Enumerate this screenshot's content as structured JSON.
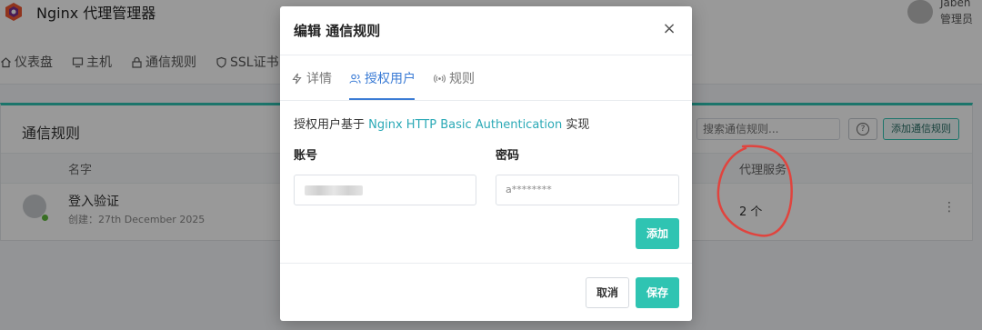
{
  "app": {
    "brand": "Nginx 代理管理器",
    "user_name": "Jaben",
    "user_role": "管理员"
  },
  "nav": [
    {
      "label": "仪表盘",
      "icon": "home-icon"
    },
    {
      "label": "主机",
      "icon": "monitor-icon"
    },
    {
      "label": "通信规则",
      "icon": "lock-icon"
    },
    {
      "label": "SSL证书",
      "icon": "shield-icon"
    }
  ],
  "card": {
    "title": "通信规则",
    "search_placeholder": "搜索通信规则...",
    "help_label": "?",
    "add_label": "添加通信规则",
    "columns": {
      "name": "名字",
      "proxy": "代理服务"
    },
    "rows": [
      {
        "name": "登入验证",
        "created": "创建：27th December 2025",
        "proxy": "2 个",
        "menu": "⋮"
      }
    ]
  },
  "modal": {
    "title": "编辑 通信规则",
    "close": "×",
    "tabs": [
      {
        "label": "详情",
        "icon": "bolt-icon"
      },
      {
        "label": "授权用户",
        "icon": "users-icon",
        "active": true
      },
      {
        "label": "规则",
        "icon": "broadcast-icon"
      }
    ],
    "desc_prefix": "授权用户基于",
    "desc_link": "Nginx HTTP Basic Authentication",
    "desc_suffix": "实现",
    "username_label": "账号",
    "password_label": "密码",
    "password_value": "a********",
    "add_button": "添加",
    "cancel_button": "取消",
    "save_button": "保存"
  },
  "colors": {
    "accent": "#2fc4b2",
    "tab_active": "#3a7bd5",
    "link": "#2aa9b6",
    "annotation": "#e0443e"
  }
}
